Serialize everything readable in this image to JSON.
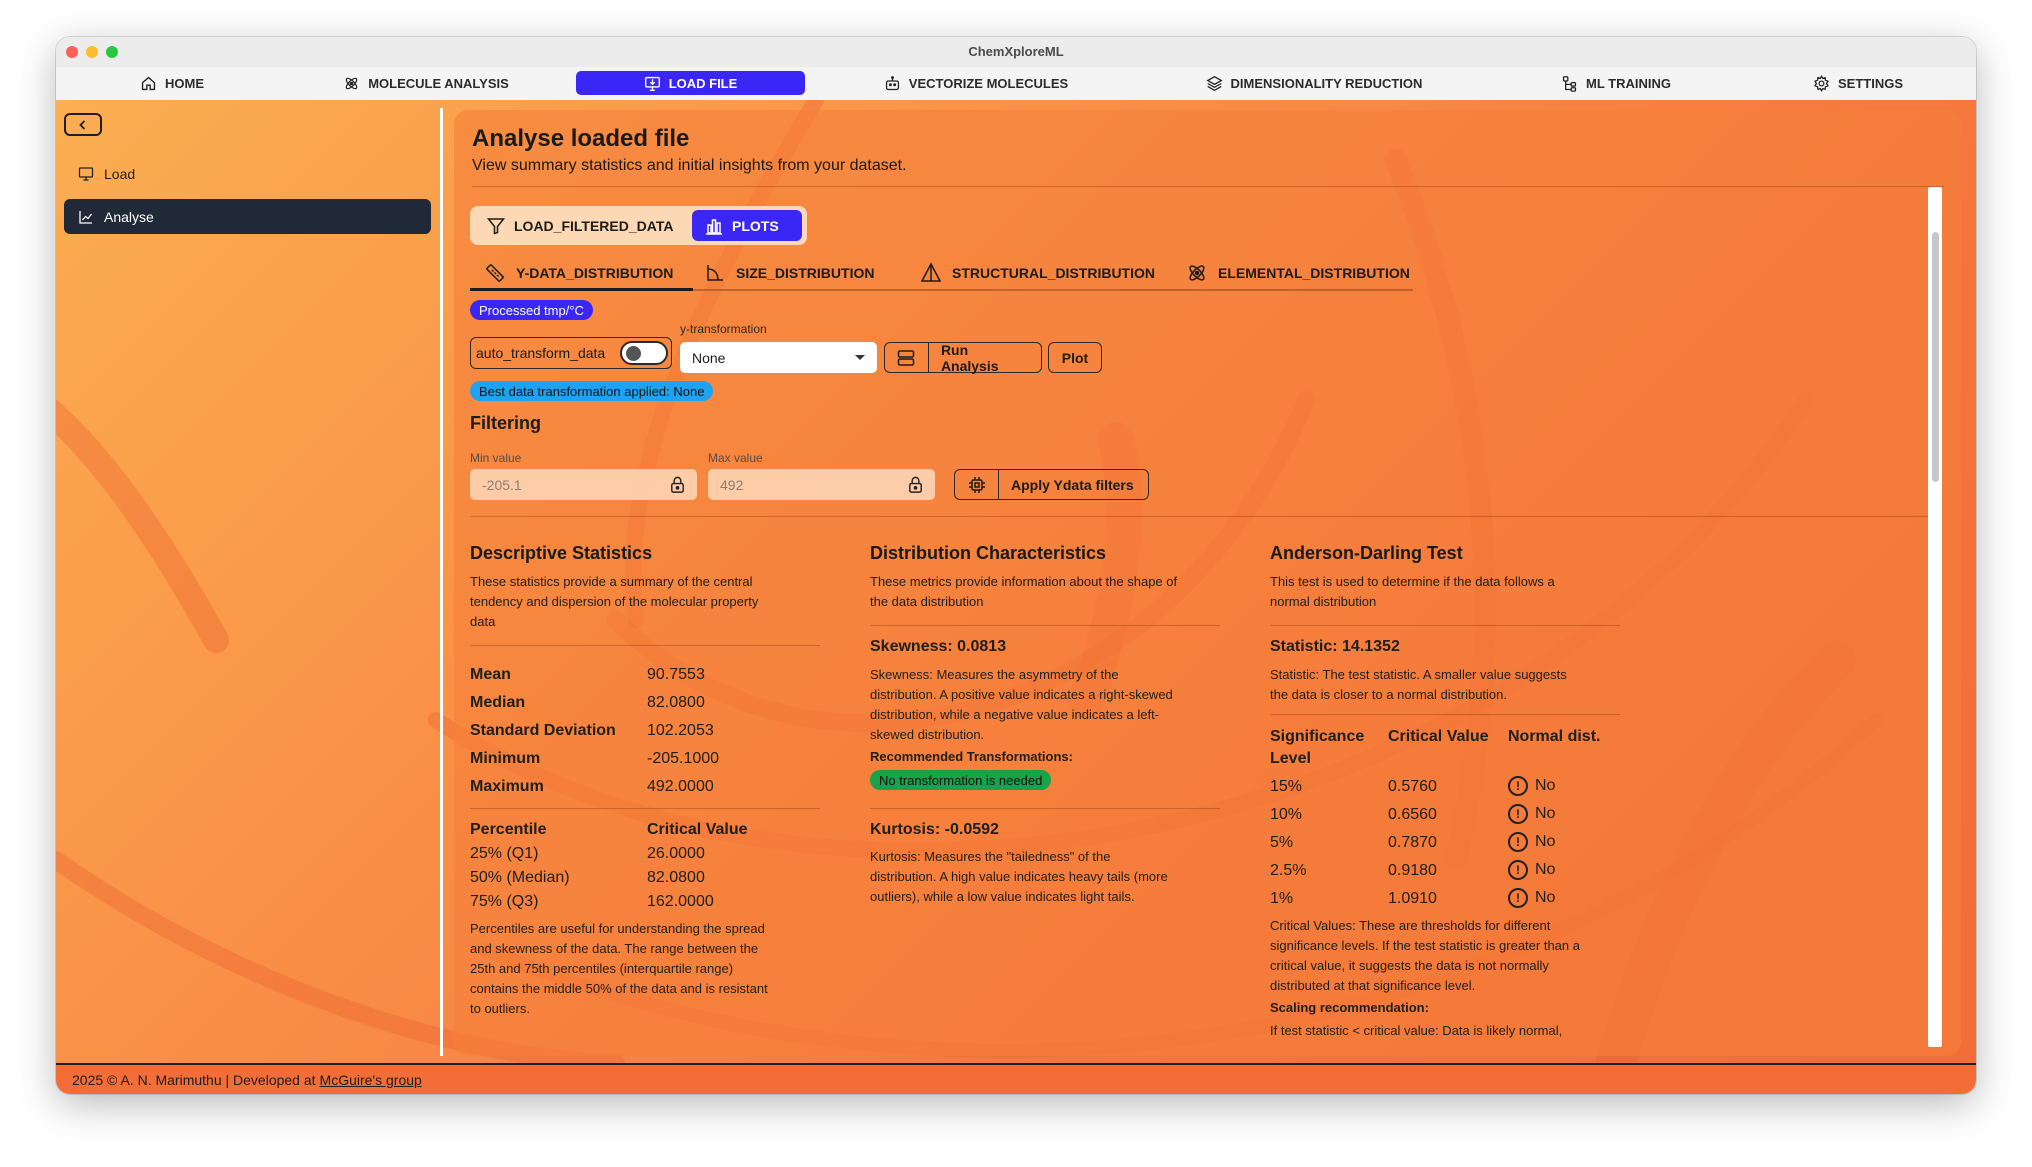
{
  "window": {
    "title": "ChemXploreML"
  },
  "nav": {
    "items": [
      {
        "label": "HOME",
        "icon": "home-icon"
      },
      {
        "label": "MOLECULE ANALYSIS",
        "icon": "atom-icon"
      },
      {
        "label": "LOAD FILE",
        "icon": "monitor-download-icon",
        "active": true
      },
      {
        "label": "VECTORIZE MOLECULES",
        "icon": "robot-icon"
      },
      {
        "label": "DIMENSIONALITY REDUCTION",
        "icon": "layers-icon"
      },
      {
        "label": "ML TRAINING",
        "icon": "tree-icon"
      },
      {
        "label": "SETTINGS",
        "icon": "gear-icon"
      }
    ]
  },
  "sidebar": {
    "items": [
      {
        "label": "Load",
        "icon": "monitor-icon"
      },
      {
        "label": "Analyse",
        "icon": "chart-icon",
        "active": true
      }
    ]
  },
  "page": {
    "title": "Analyse loaded file",
    "subtitle": "View summary statistics and initial insights from your dataset."
  },
  "segments": {
    "filter_label": "LOAD_FILTERED_DATA",
    "plots_label": "PLOTS"
  },
  "tabs": [
    "Y-DATA_DISTRIBUTION",
    "SIZE_DISTRIBUTION",
    "STRUCTURAL_DISTRIBUTION",
    "ELEMENTAL_DISTRIBUTION"
  ],
  "processed_badge": "Processed tmp/°C",
  "controls": {
    "auto_transform_label": "auto_transform_data",
    "auto_transform_on": false,
    "ytransform_label": "y-transformation",
    "ytransform_value": "None",
    "run_label": "Run Analysis",
    "plot_label": "Plot"
  },
  "best_transform_badge": "Best data transformation applied: None",
  "filtering": {
    "title": "Filtering",
    "min_label": "Min value",
    "min_placeholder": "-205.1",
    "max_label": "Max value",
    "max_placeholder": "492",
    "apply_label": "Apply Ydata filters"
  },
  "descriptive": {
    "title": "Descriptive Statistics",
    "desc_lines": [
      "These statistics provide a summary of the central",
      "tendency and dispersion of the molecular property",
      "data"
    ],
    "stats": [
      {
        "label": "Mean",
        "value": "90.7553"
      },
      {
        "label": "Median",
        "value": "82.0800"
      },
      {
        "label": "Standard Deviation",
        "value": "102.2053"
      },
      {
        "label": "Minimum",
        "value": "-205.1000"
      },
      {
        "label": "Maximum",
        "value": "492.0000"
      }
    ],
    "pct_header": "Percentile",
    "cv_header": "Critical Value",
    "percentiles": [
      {
        "label": "25% (Q1)",
        "value": "26.0000"
      },
      {
        "label": "50% (Median)",
        "value": "82.0800"
      },
      {
        "label": "75% (Q3)",
        "value": "162.0000"
      }
    ],
    "note_lines": [
      "Percentiles are useful for understanding the spread",
      "and skewness of the data. The range between the",
      "25th and 75th percentiles (interquartile range)",
      "contains the middle 50% of the data and is resistant",
      "to outliers."
    ]
  },
  "distribution": {
    "title": "Distribution Characteristics",
    "desc_lines": [
      "These metrics provide information about the shape of",
      "the data distribution"
    ],
    "skew_title": "Skewness: 0.0813",
    "skew_lines": [
      "Skewness: Measures the asymmetry of the",
      "distribution. A positive value indicates a right-skewed",
      "distribution, while a negative value indicates a left-",
      "skewed distribution."
    ],
    "rec_label": "Recommended Transformations:",
    "rec_badge": "No transformation is needed",
    "kurt_title": "Kurtosis: -0.0592",
    "kurt_lines": [
      "Kurtosis: Measures the \"tailedness\" of the",
      "distribution. A high value indicates heavy tails (more",
      "outliers), while a low value indicates light tails."
    ]
  },
  "anderson": {
    "title": "Anderson-Darling Test",
    "desc_lines": [
      "This test is used to determine if the data follows a",
      "normal distribution"
    ],
    "stat_title": "Statistic: 14.1352",
    "stat_lines": [
      "Statistic: The test statistic. A smaller value suggests",
      "the data is closer to a normal distribution."
    ],
    "headers": {
      "sig1": "Significance",
      "sig2": "Level",
      "cv": "Critical Value",
      "nd": "Normal dist."
    },
    "rows": [
      {
        "level": "15%",
        "cv": "0.5760",
        "nd": "No"
      },
      {
        "level": "10%",
        "cv": "0.6560",
        "nd": "No"
      },
      {
        "level": "5%",
        "cv": "0.7870",
        "nd": "No"
      },
      {
        "level": "2.5%",
        "cv": "0.9180",
        "nd": "No"
      },
      {
        "level": "1%",
        "cv": "1.0910",
        "nd": "No"
      }
    ],
    "cv_lines": [
      "Critical Values: These are thresholds for different",
      "significance levels. If the test statistic is greater than a",
      "critical value, it suggests the data is not normally",
      "distributed at that significance level."
    ],
    "scaling_label": "Scaling recommendation:",
    "scaling_line": "If test statistic < critical value: Data is likely normal,"
  },
  "footer": {
    "text": "2025 © A. N. Marimuthu | Developed at",
    "link": "McGuire's group"
  }
}
